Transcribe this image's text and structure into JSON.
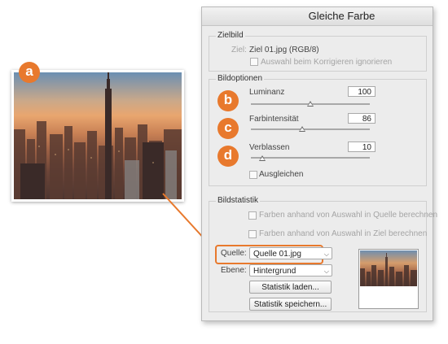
{
  "dialog": {
    "title": "Gleiche Farbe",
    "zielbild": {
      "legend": "Zielbild",
      "ziel_label": "Ziel:",
      "ziel_value": "Ziel 01.jpg (RGB/8)",
      "ignore_selection_label": "Auswahl beim Korrigieren ignorieren"
    },
    "bildoptionen": {
      "legend": "Bildoptionen",
      "luminanz_label": "Luminanz",
      "luminanz_value": "100",
      "farbintensitaet_label": "Farbintensität",
      "farbintensitaet_value": "86",
      "verblassen_label": "Verblassen",
      "verblassen_value": "10",
      "ausgleichen_label": "Ausgleichen"
    },
    "bildstatistik": {
      "legend": "Bildstatistik",
      "quelle_selection_label": "Farben anhand von Auswahl in Quelle berechnen",
      "ziel_selection_label": "Farben anhand von Auswahl in Ziel berechnen",
      "quelle_label": "Quelle:",
      "quelle_value": "Quelle 01.jpg",
      "ebene_label": "Ebene:",
      "ebene_value": "Hintergrund",
      "load_button": "Statistik laden...",
      "save_button": "Statistik speichern..."
    }
  },
  "badges": {
    "a": "a",
    "b": "b",
    "c": "c",
    "d": "d"
  },
  "colors": {
    "accent": "#e8792d",
    "dialog_bg": "#ececec"
  }
}
